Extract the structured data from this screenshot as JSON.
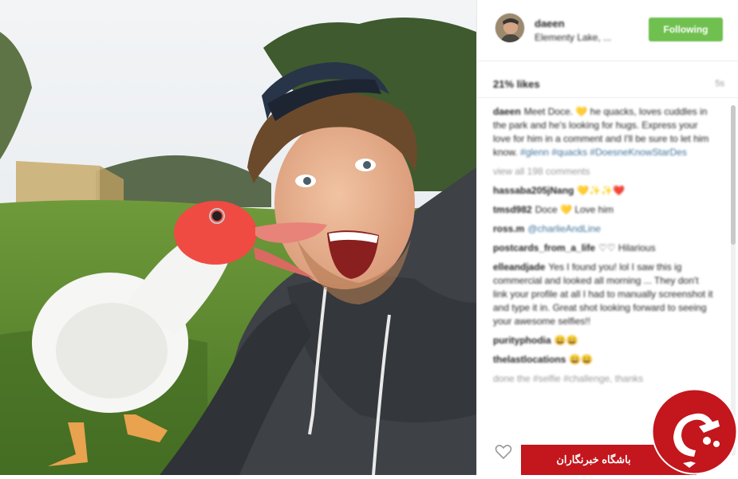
{
  "post": {
    "username": "daeen",
    "location": "Elementy Lake, ...",
    "follow_label": "Following",
    "likes": "21% likes",
    "timestamp": "5s"
  },
  "comments": [
    {
      "user": "daeen",
      "text": "Meet Doce. 💛 he quacks, loves cuddles in the park and he's looking for hugs. Express your love for him in a comment and I'll be sure to let him know.",
      "tags": "#glenn #quacks #DoesneKnowStarDes"
    },
    {
      "user": "",
      "text": "view all 198 comments",
      "muted": true
    },
    {
      "user": "hassaba205jNang",
      "text": "💛✨✨❤️"
    },
    {
      "user": "tmsd982",
      "text": "Doce 💛 Love him"
    },
    {
      "user": "ross.m",
      "text": "",
      "tags": "@charlieAndLine"
    },
    {
      "user": "postcards_from_a_life",
      "text": "♡♡ Hilarious"
    },
    {
      "user": "elleandjade",
      "text": "Yes I found you! lol I saw this ig commercial and looked all morning ... They don't link your profile at all I had to manually screenshot it and type it in. Great shot looking forward to seeing your awesome selfies!!"
    },
    {
      "user": "purityphodia",
      "text": "😀😀"
    },
    {
      "user": "thelastlocations",
      "text": "😀😀"
    },
    {
      "user": "",
      "text": "done the #selfie #challenge, thanks",
      "muted": true
    }
  ],
  "badge": {
    "text": "باشگاه خبرنگاران",
    "color": "#c3161d"
  },
  "colors": {
    "follow_green": "#70c050",
    "badge_red": "#c3161d"
  }
}
